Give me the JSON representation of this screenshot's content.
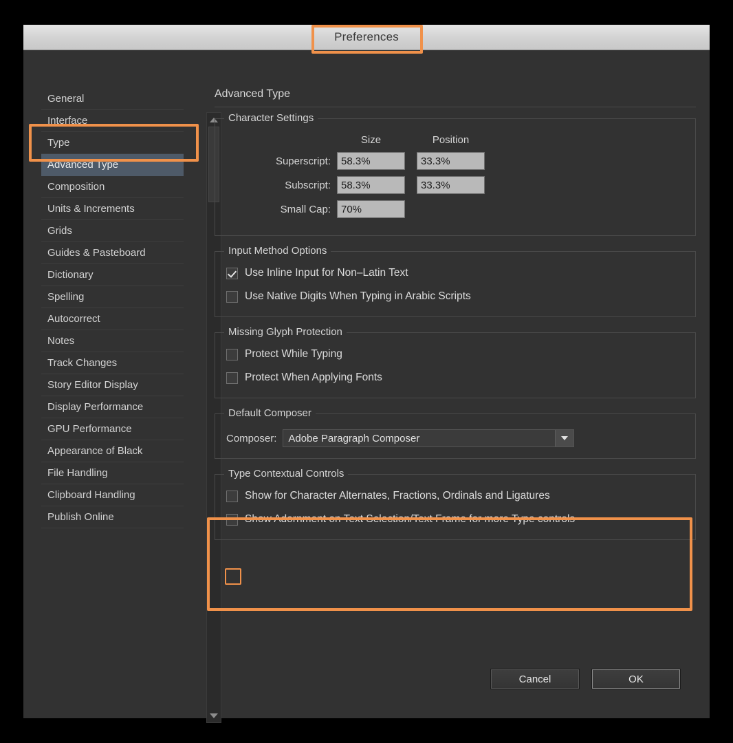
{
  "window": {
    "title": "Preferences"
  },
  "sidebar": {
    "items": [
      {
        "label": "General",
        "selected": false
      },
      {
        "label": "Interface",
        "selected": false
      },
      {
        "label": "Type",
        "selected": false
      },
      {
        "label": "Advanced Type",
        "selected": true
      },
      {
        "label": "Composition",
        "selected": false
      },
      {
        "label": "Units & Increments",
        "selected": false
      },
      {
        "label": "Grids",
        "selected": false
      },
      {
        "label": "Guides & Pasteboard",
        "selected": false
      },
      {
        "label": "Dictionary",
        "selected": false
      },
      {
        "label": "Spelling",
        "selected": false
      },
      {
        "label": "Autocorrect",
        "selected": false
      },
      {
        "label": "Notes",
        "selected": false
      },
      {
        "label": "Track Changes",
        "selected": false
      },
      {
        "label": "Story Editor Display",
        "selected": false
      },
      {
        "label": "Display Performance",
        "selected": false
      },
      {
        "label": "GPU Performance",
        "selected": false
      },
      {
        "label": "Appearance of Black",
        "selected": false
      },
      {
        "label": "File Handling",
        "selected": false
      },
      {
        "label": "Clipboard Handling",
        "selected": false
      },
      {
        "label": "Publish Online",
        "selected": false
      }
    ],
    "scrollbar": {
      "up_icon": "triangle-up-icon",
      "down_icon": "triangle-down-icon"
    }
  },
  "panel": {
    "title": "Advanced Type",
    "character_settings": {
      "legend": "Character Settings",
      "col_size": "Size",
      "col_position": "Position",
      "rows": [
        {
          "label": "Superscript:",
          "size": "58.3%",
          "position": "33.3%"
        },
        {
          "label": "Subscript:",
          "size": "58.3%",
          "position": "33.3%"
        },
        {
          "label": "Small Cap:",
          "size": "70%",
          "position": null
        }
      ]
    },
    "input_method_options": {
      "legend": "Input Method Options",
      "options": [
        {
          "label": "Use Inline Input for Non–Latin Text",
          "checked": true
        },
        {
          "label": "Use Native Digits When Typing in Arabic Scripts",
          "checked": false
        }
      ]
    },
    "missing_glyph_protection": {
      "legend": "Missing Glyph Protection",
      "options": [
        {
          "label": "Protect While Typing",
          "checked": false
        },
        {
          "label": "Protect When Applying Fonts",
          "checked": false
        }
      ]
    },
    "default_composer": {
      "legend": "Default Composer",
      "label": "Composer:",
      "value": "Adobe Paragraph Composer",
      "arrow_icon": "chevron-down-icon"
    },
    "type_contextual_controls": {
      "legend": "Type Contextual Controls",
      "options": [
        {
          "label": "Show for Character Alternates, Fractions, Ordinals and Ligatures",
          "checked": false
        },
        {
          "label": "Show Adornment on Text Selection/Text Frame for more Type controls",
          "checked": false
        }
      ]
    }
  },
  "footer": {
    "cancel_label": "Cancel",
    "ok_label": "OK"
  },
  "annotations": {
    "color": "#f0914a",
    "targets": [
      "title",
      "sidebar-advanced-type",
      "type-contextual-controls-group",
      "show-adornment-checkbox"
    ]
  },
  "colors": {
    "dialog_background": "#323232",
    "titlebar": "#d8d8d8",
    "selected_row": "#4e5a68",
    "input_field": "#b9b9b9",
    "highlight": "#f0914a",
    "text": "#d5d5d5"
  }
}
